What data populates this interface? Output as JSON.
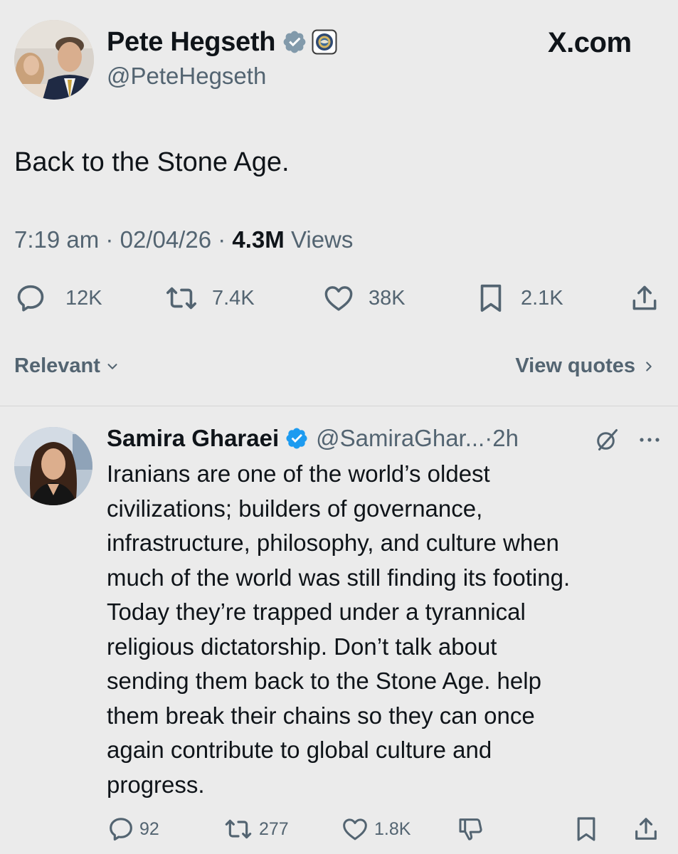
{
  "brand": {
    "site_label": "X.com"
  },
  "main_tweet": {
    "author": {
      "display_name": "Pete Hegseth",
      "handle": "@PeteHegseth",
      "verified_badge_color": "#829aab"
    },
    "text": "Back to the Stone Age.",
    "time": "7:19 am",
    "date": "02/04/26",
    "views_count": "4.3M",
    "views_label": "Views",
    "separator": "·",
    "actions": {
      "replies": "12K",
      "reposts": "7.4K",
      "likes": "38K",
      "bookmarks": "2.1K"
    }
  },
  "replies_header": {
    "sort_label": "Relevant",
    "view_quotes_label": "View quotes"
  },
  "reply": {
    "author": {
      "display_name": "Samira Gharaei",
      "handle": "@SamiraGhar...",
      "verified_badge_color": "#1d9bf0"
    },
    "separator": "·",
    "time": "2h",
    "text_lines": [
      "Iranians are one of the world’s oldest",
      "civilizations; builders of governance,",
      "infrastructure, philosophy, and culture when",
      "much of the world was still finding its footing.",
      "Today they’re trapped under a tyrannical",
      "religious dictatorship. Don’t talk about",
      "sending them back to the Stone Age. help",
      "them break their chains so they can once",
      "again contribute to global culture and",
      "progress."
    ],
    "actions": {
      "replies": "92",
      "reposts": "277",
      "likes": "1.8K"
    }
  },
  "colors": {
    "background": "#ebebeb",
    "primary_text": "#0f1419",
    "secondary_text": "#536471"
  }
}
